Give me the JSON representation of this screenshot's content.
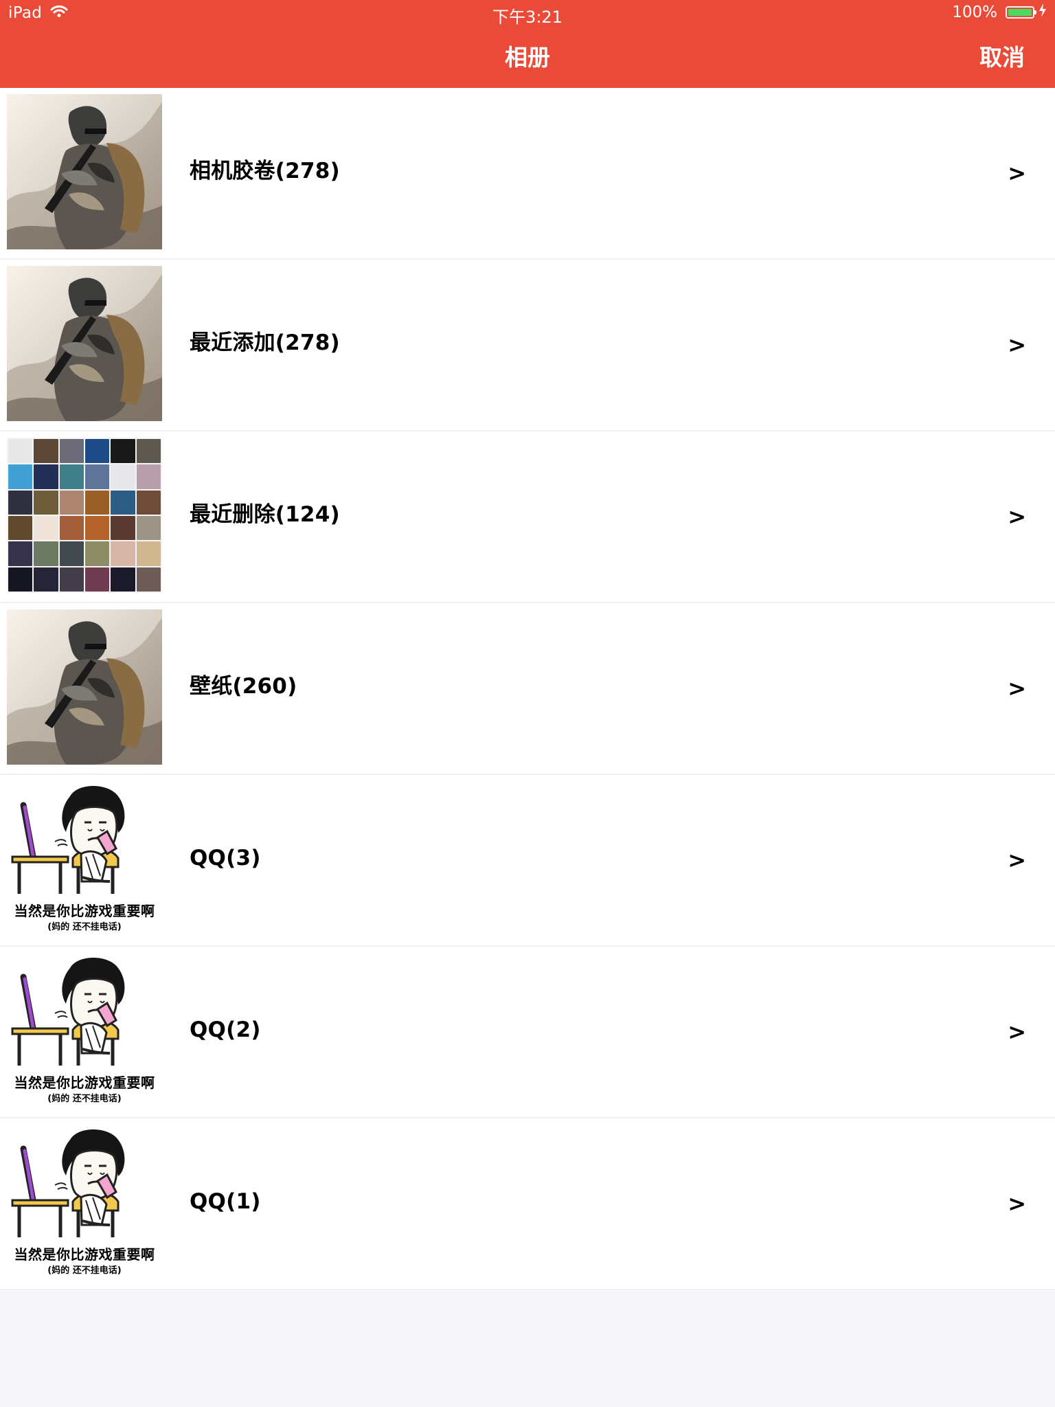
{
  "status_bar": {
    "device": "iPad",
    "time": "下午3:21",
    "battery": "100%"
  },
  "nav": {
    "title": "相册",
    "cancel": "取消"
  },
  "albums": [
    {
      "label": "相机胶卷(278)",
      "chevron": ">",
      "thumb": "soldier-photo-thumbnail"
    },
    {
      "label": "最近添加(278)",
      "chevron": ">",
      "thumb": "soldier-photo-thumbnail"
    },
    {
      "label": "最近删除(124)",
      "chevron": ">",
      "thumb": "app-grid-thumbnail"
    },
    {
      "label": "壁纸(260)",
      "chevron": ">",
      "thumb": "soldier-photo-thumbnail"
    },
    {
      "label": "QQ(3)",
      "chevron": ">",
      "thumb": "meme-thumbnail"
    },
    {
      "label": "QQ(2)",
      "chevron": ">",
      "thumb": "meme-thumbnail"
    },
    {
      "label": "QQ(1)",
      "chevron": ">",
      "thumb": "meme-thumbnail"
    }
  ],
  "meme": {
    "caption": "当然是你比游戏重要啊",
    "subcaption": "(妈的 还不挂电话)"
  },
  "colors": {
    "nav_background": "#e94b38",
    "list_background": "#ffffff",
    "page_background": "#f7f7f9"
  }
}
